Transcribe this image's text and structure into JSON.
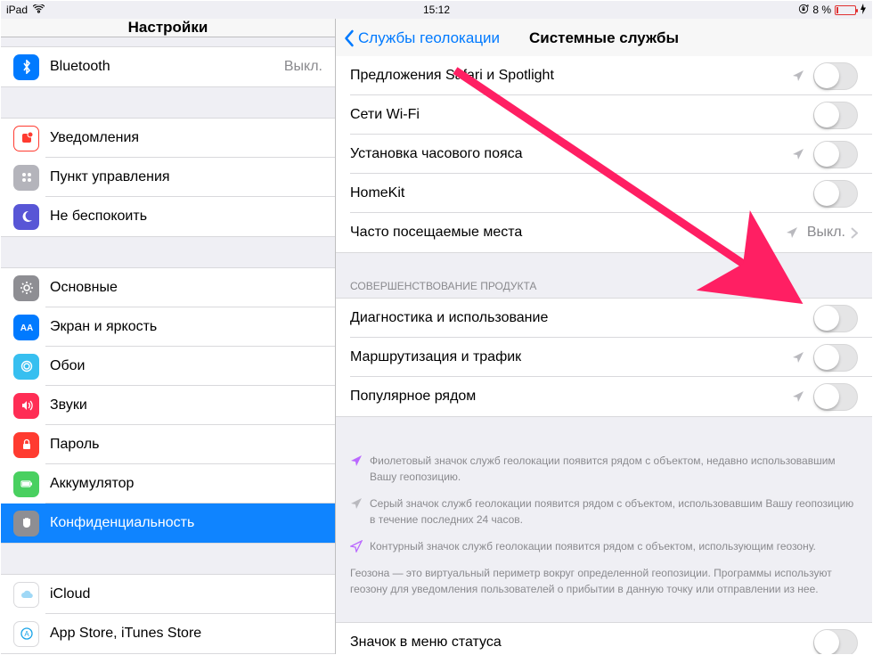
{
  "status": {
    "carrier": "iPad",
    "time": "15:12",
    "battery_pct": "8 %"
  },
  "left_header": {
    "title": "Настройки"
  },
  "right_header": {
    "back_label": "Службы геолокации",
    "title": "Системные службы"
  },
  "sidebar": {
    "g1": [
      {
        "label": "Bluetooth",
        "value": "Выкл."
      }
    ],
    "g2": [
      {
        "label": "Уведомления"
      },
      {
        "label": "Пункт управления"
      },
      {
        "label": "Не беспокоить"
      }
    ],
    "g3": [
      {
        "label": "Основные"
      },
      {
        "label": "Экран и яркость"
      },
      {
        "label": "Обои"
      },
      {
        "label": "Звуки"
      },
      {
        "label": "Пароль"
      },
      {
        "label": "Аккумулятор"
      },
      {
        "label": "Конфиденциальность"
      }
    ],
    "g4": [
      {
        "label": "iCloud",
        "sub": ""
      },
      {
        "label": "App Store, iTunes Store"
      }
    ]
  },
  "detail": {
    "section1": [
      {
        "label": "Предложения Safari и Spotlight",
        "loc": "gray_arrow",
        "accessory": "switch"
      },
      {
        "label": "Сети Wi-Fi",
        "accessory": "switch"
      },
      {
        "label": "Установка часового пояса",
        "loc": "gray_arrow",
        "accessory": "switch"
      },
      {
        "label": "HomeKit",
        "accessory": "switch"
      },
      {
        "label": "Часто посещаемые места",
        "value": "Выкл.",
        "loc": "gray_arrow",
        "accessory": "chevron"
      }
    ],
    "section2_title": "СОВЕРШЕНСТВОВАНИЕ ПРОДУКТА",
    "section2": [
      {
        "label": "Диагностика и использование",
        "accessory": "switch"
      },
      {
        "label": "Маршрутизация и трафик",
        "loc": "gray_arrow",
        "accessory": "switch"
      },
      {
        "label": "Популярное рядом",
        "loc": "gray_arrow",
        "accessory": "switch"
      }
    ],
    "footer": [
      {
        "kind": "purple",
        "text": "Фиолетовый значок служб геолокации появится рядом с объектом, недавно использовавшим Вашу геопозицию."
      },
      {
        "kind": "gray",
        "text": "Серый значок служб геолокации появится рядом с объектом, использовавшим Вашу геопозицию в течение последних 24 часов."
      },
      {
        "kind": "outline",
        "text": "Контурный значок служб геолокации появится рядом с объектом, использующим геозону."
      }
    ],
    "footer_plain": "Геозона — это виртуальный периметр вокруг определенной геопозиции. Программы используют геозону для уведомления пользователей о прибытии в данную точку или отправлении из нее.",
    "section3": [
      {
        "label": "Значок в меню статуса",
        "accessory": "switch"
      }
    ]
  }
}
